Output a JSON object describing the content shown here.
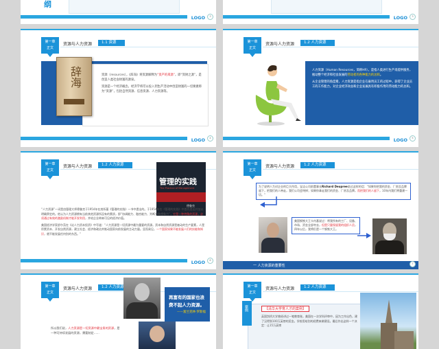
{
  "logo_text": "LOGO",
  "chapter_line1": "第一章",
  "chapter_line2": "正文",
  "section_title": "资源与人力资源",
  "top_slides": {
    "left_fragment": "纲",
    "left_page": "3",
    "right_page": "3"
  },
  "slide1": {
    "subtitle": "1.1 资源",
    "book_title": "辞海",
    "p1_pre": "资源（resources），《辞海》将资源解释为",
    "p1_hl": "“资产的来源”",
    "p1_post": "，即“资财之源”，是创造人类社会财富的源泉。",
    "p2": "资源是一个经济概念，经济学将可以投入到生产活动中创造财富的一切要素称为“资源”，包括自然资源、信息资源、人力资源等。",
    "page": "4"
  },
  "slide2": {
    "subtitle": "1.2 人力资源",
    "p1_pre": "人力资源（Human Resources，简称HR），是指人类进行生产或提供服务，推动整个经济和社会发展的",
    "p1_hl": "劳动者的各种能力的总和",
    "p1_post": "。",
    "p2": "从企业管理的角度看，人力资源是指企业在雇用员工的过程中，获得了企业员工的工作能力，对企业经济效益和企业发展具有积极作用的劳动能力的总和。",
    "page": "5"
  },
  "slide3": {
    "subtitle": "1.2 人力资源",
    "book_title": "管理的实践",
    "book_subtitle": "The Practice of Management",
    "book_author": "德鲁克",
    "p1": "“人力资源”一词是由管理大师德鲁克于1954年在其所著《管理的实践》一书中提出的。于1954年在《管理的实践》中首先提出并加以明确界定的。他认为人力资源拥有当前其他资源所没有的素质，即“协调能力、融合能力、判断力和想象力”，",
    "p1_hl": "它是一种特殊的资源，必须通过有效的激励机制才能开发利用",
    "p1_post": "，并给企业带来可见的经济价值。",
    "p2": "美国经济学家舒尔茨在《论人力资本投资》中写道：“人力资源是一切资源中最为重要的资源。资本和自然资源是被动的生产要素，人是积累资本、开发自然资源，建立社会、经济和政治并推动国家向前发展的主动力量。显而易见，",
    "p2_hl": "一个国家如果不能发展人们的技能和知识",
    "p2_post": "，就不能发展任何别的东西。”",
    "page": "6"
  },
  "slide4": {
    "subtitle": "1.2 人力资源",
    "quote_pre": "为了说明人力对企业的巨大作用，宝洁公司前董事长",
    "quote_name": "Richard Deupree",
    "quote_post": "说过这样的话：“如果你把我的资金、厂房及品牌留下，把我们的人带走，我们公司会垮掉；如果你拿走我们的资金、厂房及品牌，",
    "quote_hl": "而把我们的人留下",
    "quote_end": "，10年内我们将重建一切。”",
    "steel_pre": "美国钢铁大王卡内基说过：将我所有的工厂、设备、市场、资金全部夺去，",
    "steel_hl": "但是只要保留我的组织人员",
    "steel_post": "，四年以后，我将仍是一个钢铁大王。",
    "footer_text": "一 人力资源的重要性",
    "page": "7"
  },
  "slide5": {
    "subtitle": "1.2 人力资源",
    "banner_line1": "再富有的国家也浪",
    "banner_line2": "费不起人力资源。",
    "banner_author": "——富兰克林·罗斯福",
    "p1_pre": "所以我们说，",
    "p1_hl": "人力资源是一切资源中最宝贵的资源",
    "p1_post": "，是一种可持续发展的资源，需要制定......"
  },
  "slide6": {
    "subtitle": "1.2 人力资源",
    "case_tag": "案例",
    "case_title": "【清华大学育人才的案例】",
    "case_text": "英国剑桥大学曾经讲过一笔教育账，美国在一次学科评审中，因为工作出色，建了汉得到100万英镑的奖金。学校用给别的经费来做建设。最后作出这样一个决定：让15万英镑"
  }
}
